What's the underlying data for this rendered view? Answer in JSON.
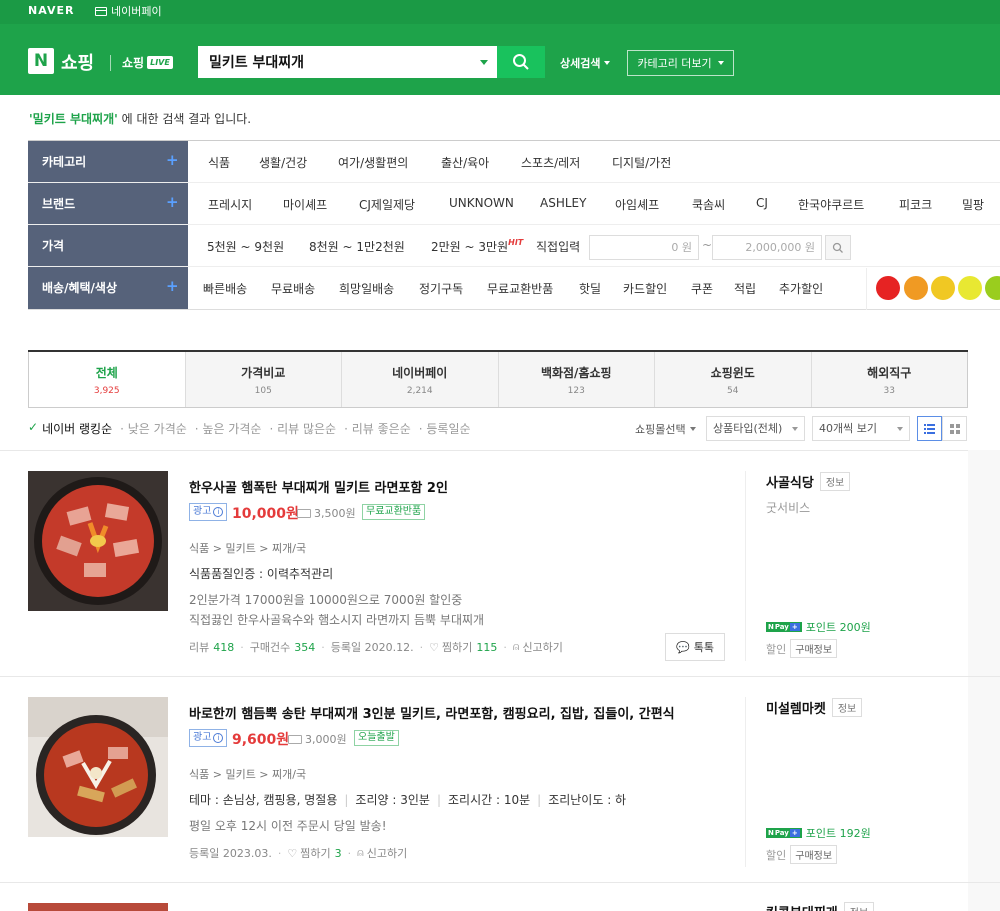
{
  "header": {
    "brand": "NAVER",
    "naverpay": "네이버페이",
    "n_logo": "N",
    "shopping": "쇼핑",
    "shopping_live": "쇼핑",
    "live": "LIVE",
    "search_value": "밀키트 부대찌개",
    "detail_search": "상세검색",
    "category_more": "카테고리 더보기"
  },
  "result": {
    "keyword": "'밀키트 부대찌개'",
    "suffix": " 에 대한 검색 결과 입니다."
  },
  "filters": {
    "category": {
      "label": "카테고리",
      "items": [
        "식품",
        "생활/건강",
        "여가/생활편의",
        "출산/육아",
        "스포츠/레저",
        "디지털/가전"
      ]
    },
    "brand": {
      "label": "브랜드",
      "items": [
        "프레시지",
        "마이셰프",
        "CJ제일제당",
        "UNKNOWN",
        "ASHLEY",
        "아임셰프",
        "쿡솜씨",
        "CJ",
        "한국야쿠르트",
        "피코크",
        "밀팡"
      ]
    },
    "price": {
      "label": "가격",
      "items": [
        "5천원 ~ 9천원",
        "8천원 ~ 1만2천원",
        "2만원 ~ 3만원"
      ],
      "hit": "HIT",
      "direct": "직접입력",
      "min": "0 원",
      "tilde": "~",
      "max": "2,000,000 원"
    },
    "delivery": {
      "label": "배송/혜택/색상",
      "items": [
        "빠른배송",
        "무료배송",
        "희망일배송",
        "정기구독",
        "무료교환반품",
        "핫딜",
        "카드할인",
        "쿠폰",
        "적립",
        "추가할인"
      ]
    },
    "colors": [
      "#e62323",
      "#f09a23",
      "#f0c823",
      "#e8e832",
      "#9acd1e"
    ]
  },
  "tabs": [
    {
      "name": "전체",
      "count": "3,925"
    },
    {
      "name": "가격비교",
      "count": "105"
    },
    {
      "name": "네이버페이",
      "count": "2,214"
    },
    {
      "name": "백화점/홈쇼핑",
      "count": "123"
    },
    {
      "name": "쇼핑윈도",
      "count": "54"
    },
    {
      "name": "해외직구",
      "count": "33"
    }
  ],
  "sort": {
    "active": "네이버 랭킹순",
    "options": [
      "· 낮은 가격순",
      "· 높은 가격순",
      "· 리뷰 많은순",
      "· 리뷰 좋은순",
      "· 등록일순"
    ],
    "mall_select": "쇼핑몰선택",
    "product_type": "상품타입(전체)",
    "per_page": "40개씩 보기"
  },
  "products": [
    {
      "title": "한우사골 햄폭탄 부대찌개 밀키트 라면포함 2인",
      "ad": "광고",
      "price": "10,000원",
      "shipping": "3,500원",
      "tag": "무료교환반품",
      "category": "식품 > 밀키트 > 찌개/국",
      "line1": "식품품질인증 : 이력추적관리",
      "desc1": "2인분가격 17000원을 10000원으로 7000원 할인중",
      "desc2": "직접끓인 한우사골육수와 햄소시지 라면까지 듬뿍 부대찌개",
      "review_label": "리뷰",
      "review": "418",
      "buy_label": "구매건수",
      "buy": "354",
      "date": "등록일 2020.12.",
      "like_label": "찜하기",
      "like": "115",
      "report": "신고하기",
      "talk": "톡톡",
      "mall": "사골식당",
      "mall_info": "정보",
      "mall_sub": "굿서비스",
      "point": "포인트 200원",
      "discount": "할인",
      "buyinfo": "구매정보"
    },
    {
      "title": "바로한끼 햄듬뿍 송탄 부대찌개 3인분 밀키트, 라면포함, 캠핑요리, 집밥, 집들이, 간편식",
      "ad": "광고",
      "price": "9,600원",
      "shipping": "3,000원",
      "tag": "오늘출발",
      "category": "식품 > 밀키트 > 찌개/국",
      "specs": [
        "테마 : 손님상, 캠핑용, 명절용",
        "조리양 : 3인분",
        "조리시간 : 10분",
        "조리난이도 : 하"
      ],
      "desc1": "평일 오후 12시 이전 주문시 당일 발송!",
      "date": "등록일 2023.03.",
      "like_label": "찜하기",
      "like": "3",
      "report": "신고하기",
      "mall": "미설렘마켓",
      "mall_info": "정보",
      "point": "포인트 192원",
      "discount": "할인",
      "buyinfo": "구매정보"
    },
    {
      "mall": "킹콩부대찌개",
      "mall_info": "정보"
    }
  ],
  "npay": {
    "n": "N",
    "pay": "Pay",
    "plus": "+"
  }
}
